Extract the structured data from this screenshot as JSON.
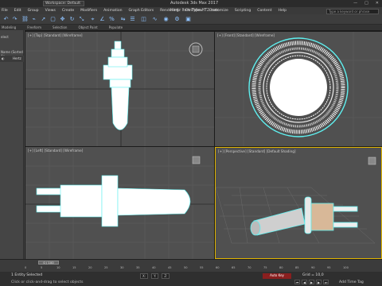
{
  "window": {
    "workspace": "Workspace: Default",
    "app_title": "Autodesk 3ds Max 2017",
    "file_title": "Hertz Item Type HT2.max",
    "search_placeholder": "Type a keyword or phrase"
  },
  "menu": [
    "File",
    "Edit",
    "Group",
    "Views",
    "Create",
    "Modifiers",
    "Animation",
    "Graph Editors",
    "Rendering",
    "Civil View",
    "Customize",
    "Scripting",
    "Content",
    "Help"
  ],
  "toolbar": {
    "selection_set": "Create Selection Se"
  },
  "ribbon": [
    "Modeling",
    "Freeform",
    "Selection",
    "Object Paint",
    "Populate"
  ],
  "left_panel": {
    "title": "elect",
    "row_text": "Name (Sorted As",
    "item": "Hertz"
  },
  "viewports": {
    "top": "[+] [Top] [Standard] [Wireframe]",
    "front": "[+] [Front] [Standard] [Wireframe]",
    "left": "[+] [Left] [Standard] [Wireframe]",
    "perspective": "[+] [Perspective] [Standard] [Default Shading]"
  },
  "timeline": {
    "slider": "0 / 100",
    "ticks": [
      "0",
      "5",
      "10",
      "15",
      "20",
      "25",
      "30",
      "35",
      "40",
      "45",
      "50",
      "55",
      "60",
      "65",
      "70",
      "75",
      "80",
      "85",
      "90",
      "95",
      "100"
    ]
  },
  "status": {
    "selected": "1 Entity Selected",
    "prompt": "Click or click-and-drag to select objects",
    "x": "X:",
    "y": "Y:",
    "z": "Z:",
    "grid": "Grid = 10,0",
    "add_time_tag": "Add Time Tag",
    "auto_key": "Auto Key"
  },
  "colors": {
    "wire": "#ffffff",
    "selected_outline": "#5ff0f0",
    "active_viewport": "#e0b400"
  }
}
